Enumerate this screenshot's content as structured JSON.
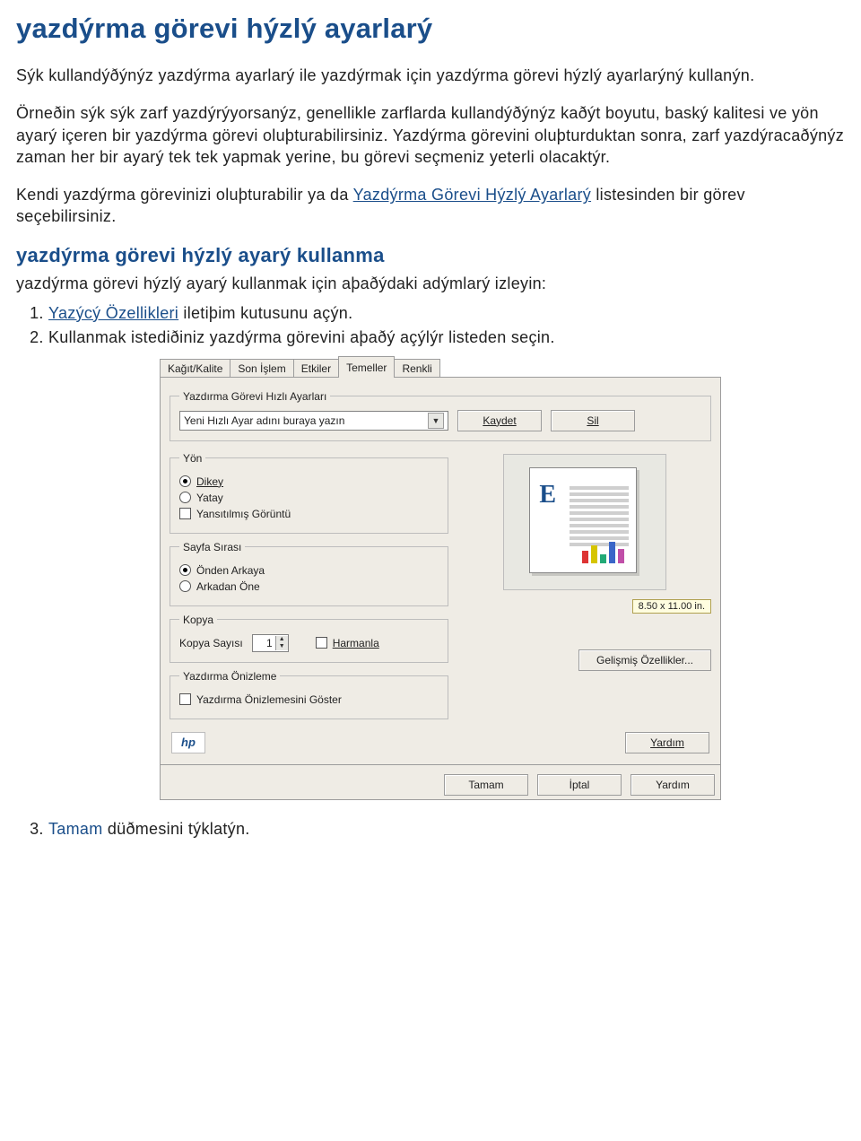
{
  "page": {
    "title": "yazdýrma görevi hýzlý ayarlarý"
  },
  "paragraphs": {
    "p1": "Sýk kullandýðýnýz yazdýrma ayarlarý ile yazdýrmak için yazdýrma görevi hýzlý ayarlarýný kullanýn.",
    "p2": "Örneðin sýk sýk zarf yazdýrýyorsanýz, genellikle zarflarda kullandýðýnýz kaðýt boyutu, baský kalitesi ve yön ayarý içeren bir yazdýrma görevi oluþturabilirsiniz. Yazdýrma görevini oluþturduktan sonra, zarf yazdýracaðýnýz zaman her bir ayarý tek tek yapmak yerine, bu görevi seçmeniz yeterli olacaktýr.",
    "p3_a": "Kendi yazdýrma görevinizi oluþturabilir ya da ",
    "p3_link": "Yazdýrma Görevi Hýzlý Ayarlarý",
    "p3_b": " listesinden bir görev seçebilirsiniz."
  },
  "section": {
    "title": "yazdýrma görevi hýzlý ayarý kullanma",
    "intro": "yazdýrma görevi hýzlý ayarý kullanmak için aþaðýdaki adýmlarý izleyin:"
  },
  "steps": {
    "s1_a": "Yazýcý Özellikleri",
    "s1_b": " iletiþim kutusunu açýn.",
    "s2": "Kullanmak istediðiniz yazdýrma görevini aþaðý açýlýr listeden seçin.",
    "s3_a": "Tamam",
    "s3_b": " düðmesini týklatýn."
  },
  "dialog": {
    "tabs": {
      "t1": "Kağıt/Kalite",
      "t2": "Son İşlem",
      "t3": "Etkiler",
      "t4": "Temeller",
      "t5": "Renkli"
    },
    "quick": {
      "legend": "Yazdırma Görevi Hızlı Ayarları",
      "combo_text": "Yeni Hızlı Ayar adını buraya yazın",
      "save": "Kaydet",
      "delete": "Sil"
    },
    "orient": {
      "legend": "Yön",
      "r1": "Dikey",
      "r2": "Yatay",
      "c1": "Yansıtılmış Görüntü"
    },
    "page_order": {
      "legend": "Sayfa Sırası",
      "r1": "Önden Arkaya",
      "r2": "Arkadan Öne"
    },
    "copies": {
      "legend": "Kopya",
      "label": "Kopya Sayısı",
      "value": "1",
      "collate": "Harmanla"
    },
    "preview_group": {
      "legend": "Yazdırma Önizleme",
      "check": "Yazdırma Önizlemesini Göster"
    },
    "preview_size": "8.50 x 11.00 in.",
    "advanced": "Gelişmiş Özellikler...",
    "help": "Yardım",
    "hp": "hp",
    "footer": {
      "ok": "Tamam",
      "cancel": "İptal",
      "help": "Yardım"
    }
  }
}
